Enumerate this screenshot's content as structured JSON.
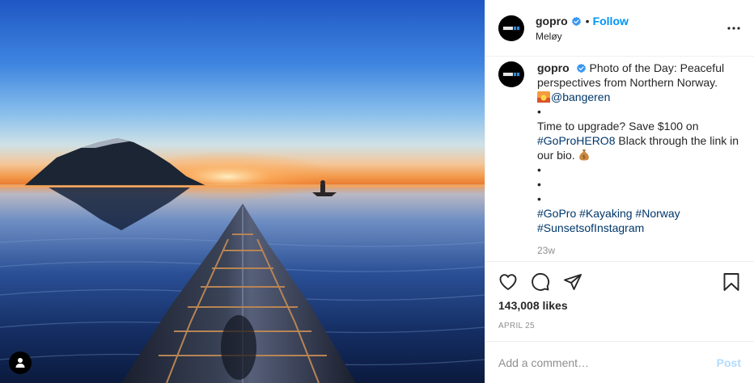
{
  "post": {
    "image_alt": "Kayak bow pointing toward a sunset over calm water with a mountain island",
    "colors": {
      "follow_blue": "#0095f6",
      "hashtag_blue": "#00376b",
      "verified_blue": "#3897f0",
      "muted_gray": "#8e8e8e",
      "post_button_disabled": "#b3dbff"
    }
  },
  "header": {
    "username": "gopro",
    "separator": "•",
    "follow_label": "Follow",
    "location": "Meløy"
  },
  "caption": {
    "username": "gopro",
    "text_intro": "Photo of the Day: Peaceful perspectives from Northern Norway.",
    "mention": "@bangeren",
    "dot": "•",
    "text_upgrade_before": "Time to upgrade? Save $100 on",
    "hashtag_hero": "#GoProHERO8",
    "text_upgrade_after": "Black through the link in our bio.",
    "hashtags": [
      "#GoPro",
      "#Kayaking",
      "#Norway",
      "#SunsetsofInstagram"
    ],
    "time_ago": "23w"
  },
  "actions": {
    "icons": [
      "heart-icon",
      "comment-icon",
      "share-icon",
      "bookmark-icon"
    ],
    "likes": "143,008 likes",
    "date": "APRIL 25"
  },
  "comment_box": {
    "placeholder": "Add a comment…",
    "post_label": "Post"
  }
}
